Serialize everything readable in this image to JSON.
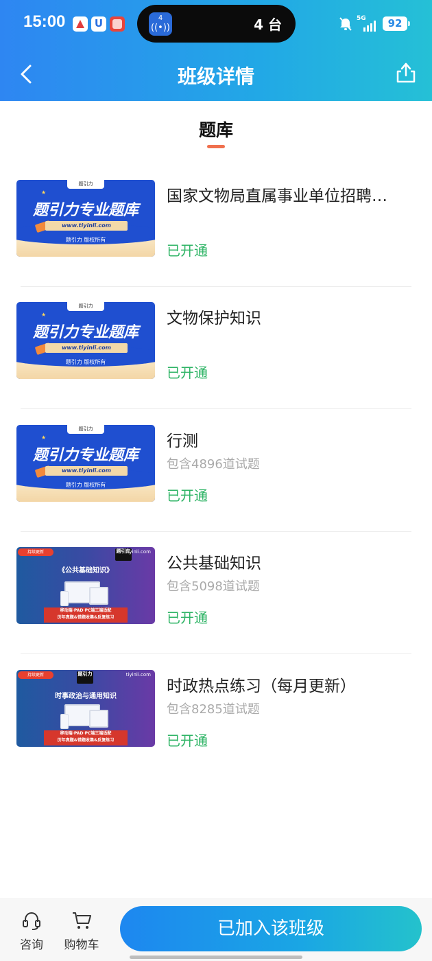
{
  "status_bar": {
    "time": "15:00",
    "island_text": "4 台",
    "island_badge": "4",
    "network": "5G",
    "battery": "92"
  },
  "nav": {
    "title": "班级详情"
  },
  "section": {
    "tab_label": "题库"
  },
  "courses": [
    {
      "title": "国家文物局直属事业单位招聘…",
      "count": "",
      "status": "已开通",
      "thumb": {
        "style": "blue",
        "big_text": "题引力专业题库",
        "url": "www.tiyinli.com",
        "copyright": "题引力 版权所有",
        "logo": "题引力"
      }
    },
    {
      "title": "文物保护知识",
      "count": "",
      "status": "已开通",
      "thumb": {
        "style": "blue",
        "big_text": "题引力专业题库",
        "url": "www.tiyinli.com",
        "copyright": "题引力 版权所有",
        "logo": "题引力"
      }
    },
    {
      "title": "行测",
      "count": "包含4896道试题",
      "status": "已开通",
      "thumb": {
        "style": "blue",
        "big_text": "题引力专业题库",
        "url": "www.tiyinli.com",
        "copyright": "题引力 版权所有",
        "logo": "题引力"
      }
    },
    {
      "title": "公共基础知识",
      "count": "包含5098道试题",
      "status": "已开通",
      "thumb": {
        "style": "purple",
        "badge": "持续更新",
        "site": "tiyinli.com",
        "heading": "《公共基础知识》",
        "line1": "移动端·PAD·PC端三端适配",
        "line2": "历年真题&错题收集&反复练习",
        "brand": "题引力"
      }
    },
    {
      "title": "时政热点练习（每月更新）",
      "count": "包含8285道试题",
      "status": "已开通",
      "thumb": {
        "style": "purple",
        "badge": "持续更新",
        "site": "tiyinli.com",
        "heading": "时事政治与通用知识",
        "line1": "移动端·PAD·PC端三端适配",
        "line2": "历年真题&错题收集&反复练习",
        "brand": "题引力"
      }
    }
  ],
  "bottom_bar": {
    "consult_label": "咨询",
    "cart_label": "购物车",
    "joined_label": "已加入该班级"
  },
  "colors": {
    "accent": "#1d87f0",
    "status_green": "#2fb466",
    "tab_underline": "#f0704e"
  }
}
